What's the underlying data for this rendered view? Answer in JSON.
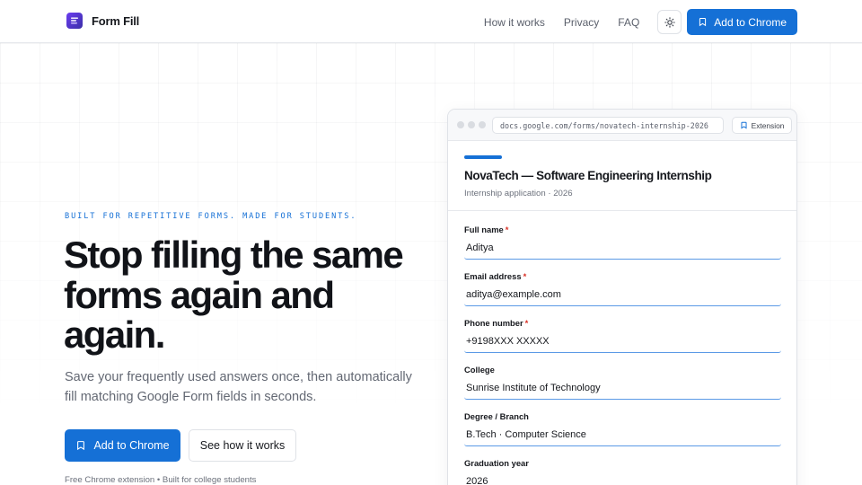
{
  "brand": {
    "name": "Form Fill",
    "logo_icon": "form-logo-icon"
  },
  "nav": {
    "links": [
      "How it works",
      "Privacy",
      "FAQ"
    ],
    "theme_icon": "sun-icon",
    "cta_label": "Add to Chrome"
  },
  "hero": {
    "eyebrow": "BUILT FOR REPETITIVE FORMS. MADE FOR STUDENTS.",
    "headline": "Stop filling the same forms again and again.",
    "subtext": "Save your frequently used answers once, then automatically fill matching Google Form fields in seconds.",
    "primary_cta": "Add to Chrome",
    "secondary_cta": "See how it works",
    "footnote": "Free Chrome extension • Built for college students"
  },
  "mock": {
    "url": "docs.google.com/forms/novatech-internship-2026",
    "extension_badge": "Extension",
    "form_title": "NovaTech — Software Engineering Internship",
    "form_subtitle": "Internship application · 2026",
    "fields": [
      {
        "label": "Full name",
        "required": true,
        "value": "Aditya"
      },
      {
        "label": "Email address",
        "required": true,
        "value": "aditya@example.com"
      },
      {
        "label": "Phone number",
        "required": true,
        "value": "+9198XXX XXXXX"
      },
      {
        "label": "College",
        "required": false,
        "value": "Sunrise Institute of Technology"
      },
      {
        "label": "Degree / Branch",
        "required": false,
        "value": "B.Tech · Computer Science"
      },
      {
        "label": "Graduation year",
        "required": false,
        "value": "2026"
      }
    ]
  },
  "colors": {
    "accent": "#1570d6",
    "required": "#d93025",
    "text": "#16181d",
    "muted": "#636873"
  }
}
